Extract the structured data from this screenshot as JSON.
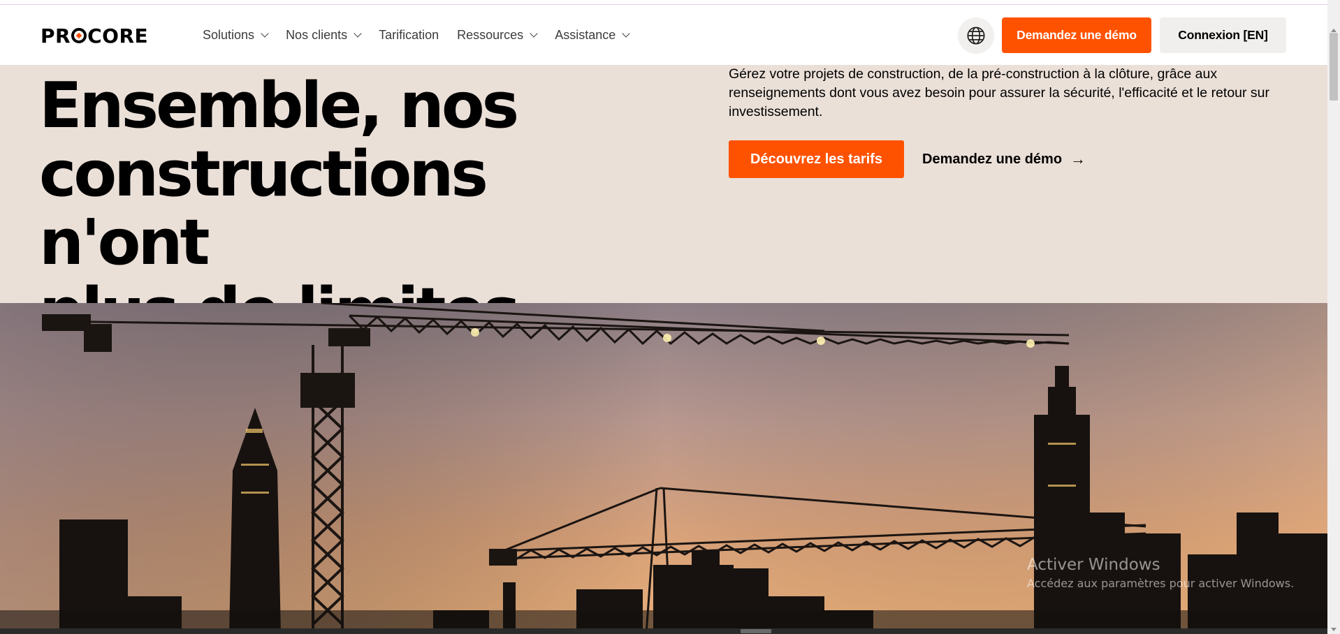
{
  "brand": {
    "logo_text_pre": "PR",
    "logo_text_post": "CORE",
    "accent_color": "#ff5200"
  },
  "nav": {
    "items": [
      {
        "label": "Solutions",
        "has_dropdown": true
      },
      {
        "label": "Nos clients",
        "has_dropdown": true
      },
      {
        "label": "Tarification",
        "has_dropdown": false
      },
      {
        "label": "Ressources",
        "has_dropdown": true
      },
      {
        "label": "Assistance",
        "has_dropdown": true
      }
    ],
    "globe_icon": "globe-icon",
    "demo_button": "Demandez une démo",
    "login_button": "Connexion [EN]"
  },
  "hero": {
    "title_line1": "Ensemble, nos",
    "title_line2": "constructions n'ont",
    "title_line3": "plus de limites",
    "description": "Gérez votre projets de construction, de la pré-construction à la clôture, grâce aux renseignements dont vous avez besoin pour assurer la sécurité, l'efficacité et le retour sur investissement.",
    "primary_cta": "Découvrez les tarifs",
    "secondary_cta": "Demandez une démo",
    "secondary_cta_icon": "arrow-right-icon",
    "background_color": "#ebe0d8"
  },
  "watermark": {
    "line1": "Activer Windows",
    "line2": "Accédez aux paramètres pour activer Windows."
  }
}
